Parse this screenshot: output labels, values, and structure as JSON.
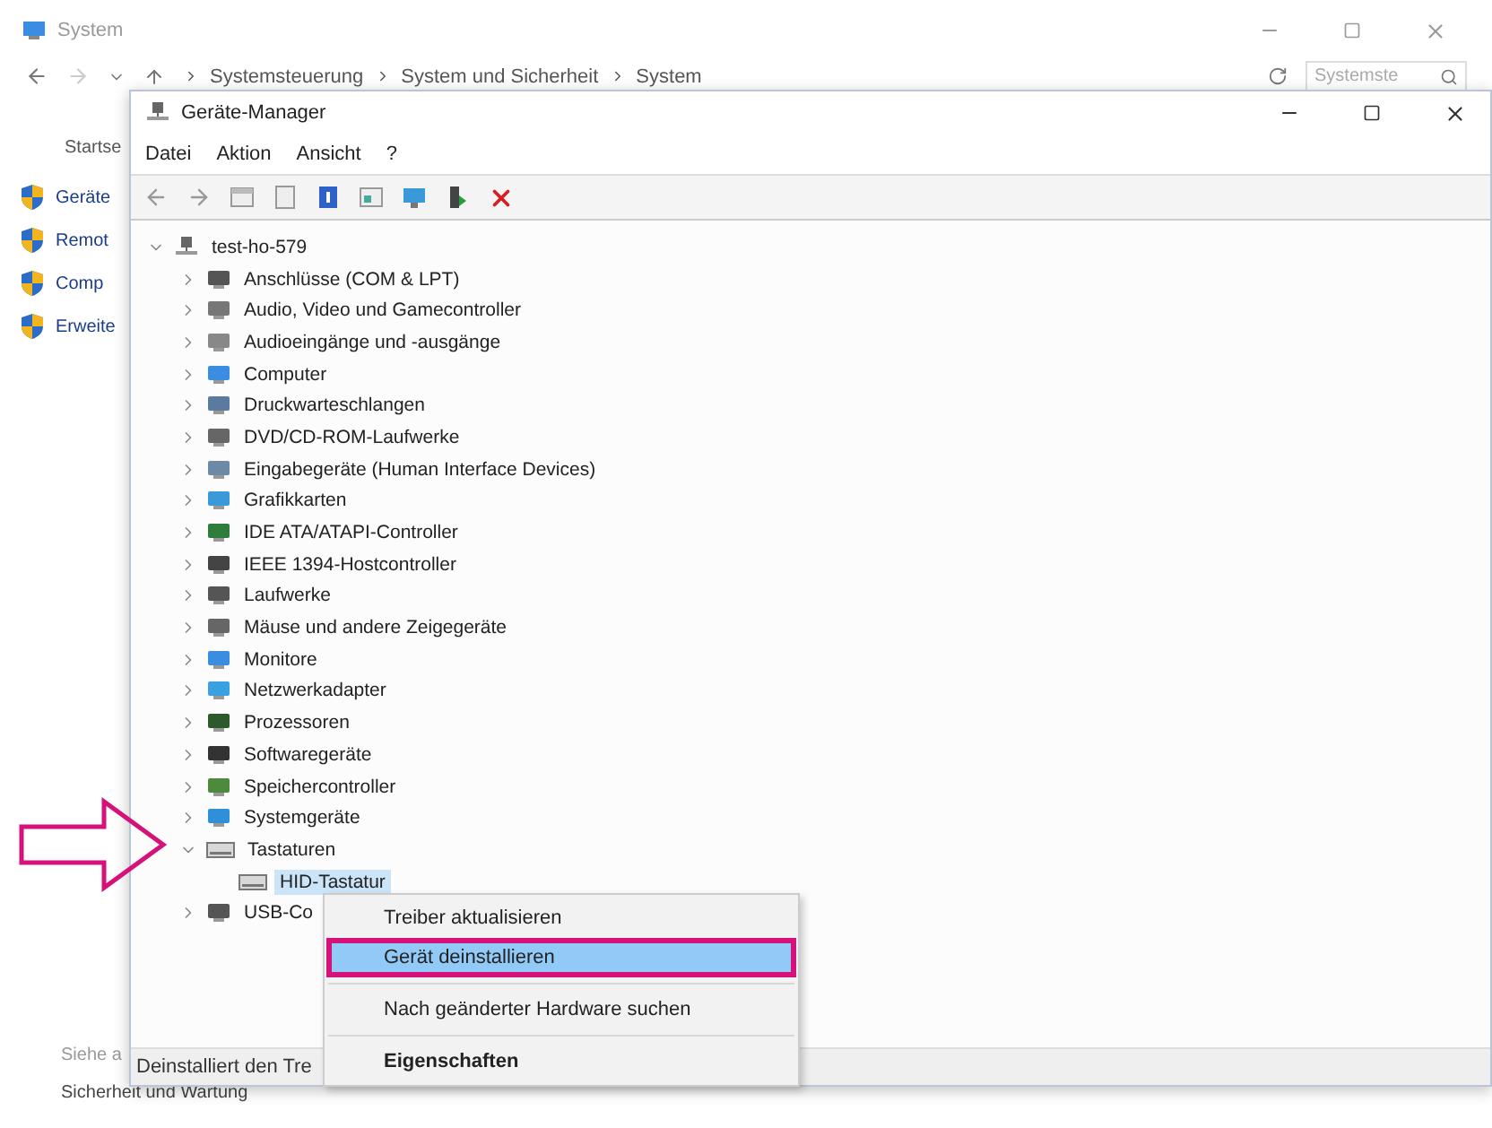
{
  "background_window": {
    "title": "System",
    "breadcrumb": [
      "Systemsteuerung",
      "System und Sicherheit",
      "System"
    ],
    "search": {
      "placeholder": "Systemste"
    },
    "sidebar": {
      "home": "Startse",
      "links": [
        "Geräte",
        "Remot",
        "Comp",
        "Erweite"
      ],
      "see_also": "Siehe a",
      "bottom_link": "Sicherheit und Wartung"
    }
  },
  "device_manager": {
    "title": "Geräte-Manager",
    "menu": [
      "Datei",
      "Aktion",
      "Ansicht",
      "?"
    ],
    "tree": {
      "label": "test-ho-579",
      "expanded": true,
      "selected": false,
      "children": [
        {
          "label": "Anschlüsse (COM & LPT)",
          "expanded": false,
          "selected": false
        },
        {
          "label": "Audio, Video und Gamecontroller",
          "expanded": false,
          "selected": false
        },
        {
          "label": "Audioeingänge und -ausgänge",
          "expanded": false,
          "selected": false
        },
        {
          "label": "Computer",
          "expanded": false,
          "selected": false
        },
        {
          "label": "Druckwarteschlangen",
          "expanded": false,
          "selected": false
        },
        {
          "label": "DVD/CD-ROM-Laufwerke",
          "expanded": false,
          "selected": false
        },
        {
          "label": "Eingabegeräte (Human Interface Devices)",
          "expanded": false,
          "selected": false
        },
        {
          "label": "Grafikkarten",
          "expanded": false,
          "selected": false
        },
        {
          "label": "IDE ATA/ATAPI-Controller",
          "expanded": false,
          "selected": false
        },
        {
          "label": "IEEE 1394-Hostcontroller",
          "expanded": false,
          "selected": false
        },
        {
          "label": "Laufwerke",
          "expanded": false,
          "selected": false
        },
        {
          "label": "Mäuse und andere Zeigegeräte",
          "expanded": false,
          "selected": false
        },
        {
          "label": "Monitore",
          "expanded": false,
          "selected": false
        },
        {
          "label": "Netzwerkadapter",
          "expanded": false,
          "selected": false
        },
        {
          "label": "Prozessoren",
          "expanded": false,
          "selected": false
        },
        {
          "label": "Softwaregeräte",
          "expanded": false,
          "selected": false
        },
        {
          "label": "Speichercontroller",
          "expanded": false,
          "selected": false
        },
        {
          "label": "Systemgeräte",
          "expanded": false,
          "selected": false
        },
        {
          "label": "Tastaturen",
          "expanded": true,
          "selected": false,
          "children": [
            {
              "label": "HID-Tastatur",
              "selected": true
            }
          ]
        },
        {
          "label": "USB-Co",
          "expanded": false,
          "selected": false
        }
      ]
    },
    "status_bar": "Deinstalliert den Tre"
  },
  "context_menu": {
    "items": [
      {
        "label": "Treiber aktualisieren",
        "highlighted": false,
        "marked": false,
        "bold": false
      },
      {
        "label": "Gerät deinstallieren",
        "highlighted": true,
        "marked": true,
        "bold": false
      },
      {
        "label": "Nach geänderter Hardware suchen",
        "highlighted": false,
        "marked": false,
        "bold": false
      },
      {
        "label": "Eigenschaften",
        "highlighted": false,
        "marked": false,
        "bold": true
      }
    ]
  }
}
